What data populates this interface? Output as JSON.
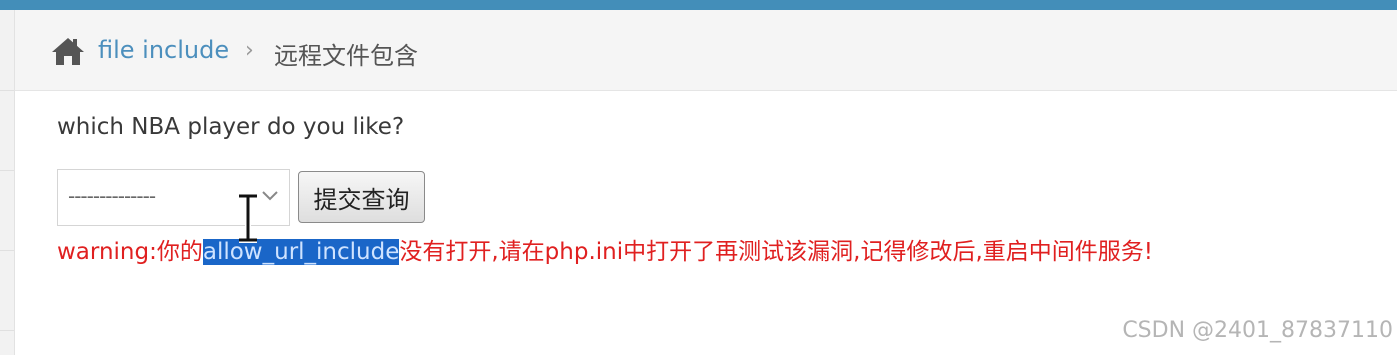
{
  "header": {
    "accent_color": "#438eb9"
  },
  "breadcrumb": {
    "home_icon": "home-icon",
    "link_label": "file include",
    "separator": "›",
    "current_label": "远程文件包含"
  },
  "form": {
    "question": "which NBA player do you like?",
    "select_value": "--------------",
    "submit_label": "提交查询"
  },
  "warning": {
    "prefix": "warning:你的",
    "highlighted": "allow_url_include",
    "suffix": "没有打开,请在php.ini中打开了再测试该漏洞,记得修改后,重启中间件服务!",
    "color": "#e02020"
  },
  "watermark": {
    "text": "CSDN @2401_87837110"
  }
}
